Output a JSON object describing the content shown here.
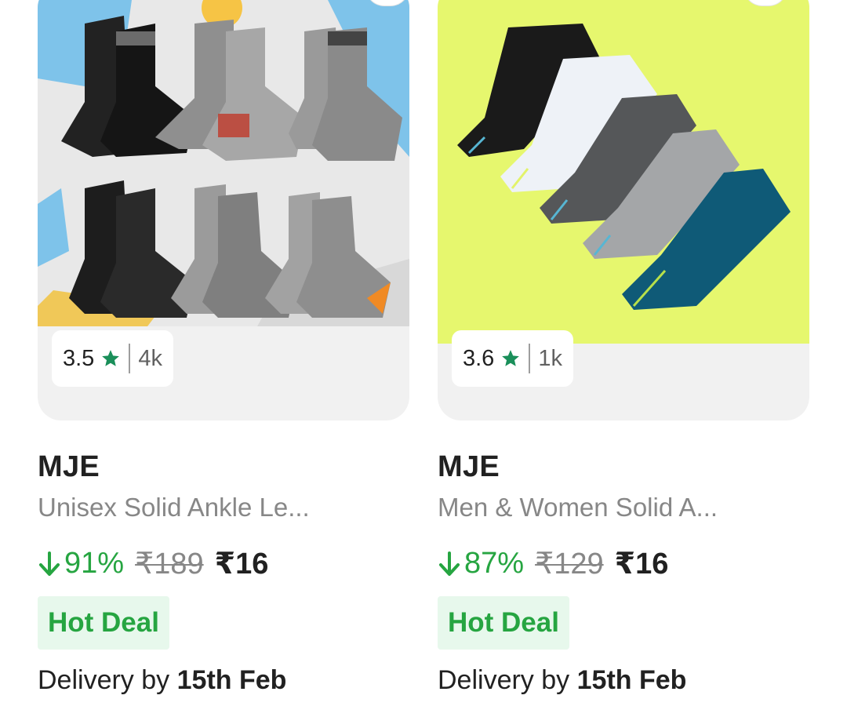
{
  "products": [
    {
      "rating": "3.5",
      "rating_count": "4k",
      "brand": "MJE",
      "title": "Unisex Solid Ankle Le...",
      "discount": "91%",
      "mrp": "₹189",
      "price": "₹16",
      "deal_label": "Hot Deal",
      "delivery_prefix": "Delivery by",
      "delivery_date": "15th Feb"
    },
    {
      "rating": "3.6",
      "rating_count": "1k",
      "brand": "MJE",
      "title": "Men & Women Solid A...",
      "discount": "87%",
      "mrp": "₹129",
      "price": "₹16",
      "deal_label": "Hot Deal",
      "delivery_prefix": "Delivery by",
      "delivery_date": "15th Feb"
    }
  ],
  "icons": {
    "rating": "star-icon",
    "discount": "arrow-down-icon"
  },
  "colors": {
    "discount_green": "#26a541",
    "rating_star": "#1a8f5a",
    "deal_bg": "#e7f8ec",
    "image_bg_right": "#e6f76e"
  }
}
